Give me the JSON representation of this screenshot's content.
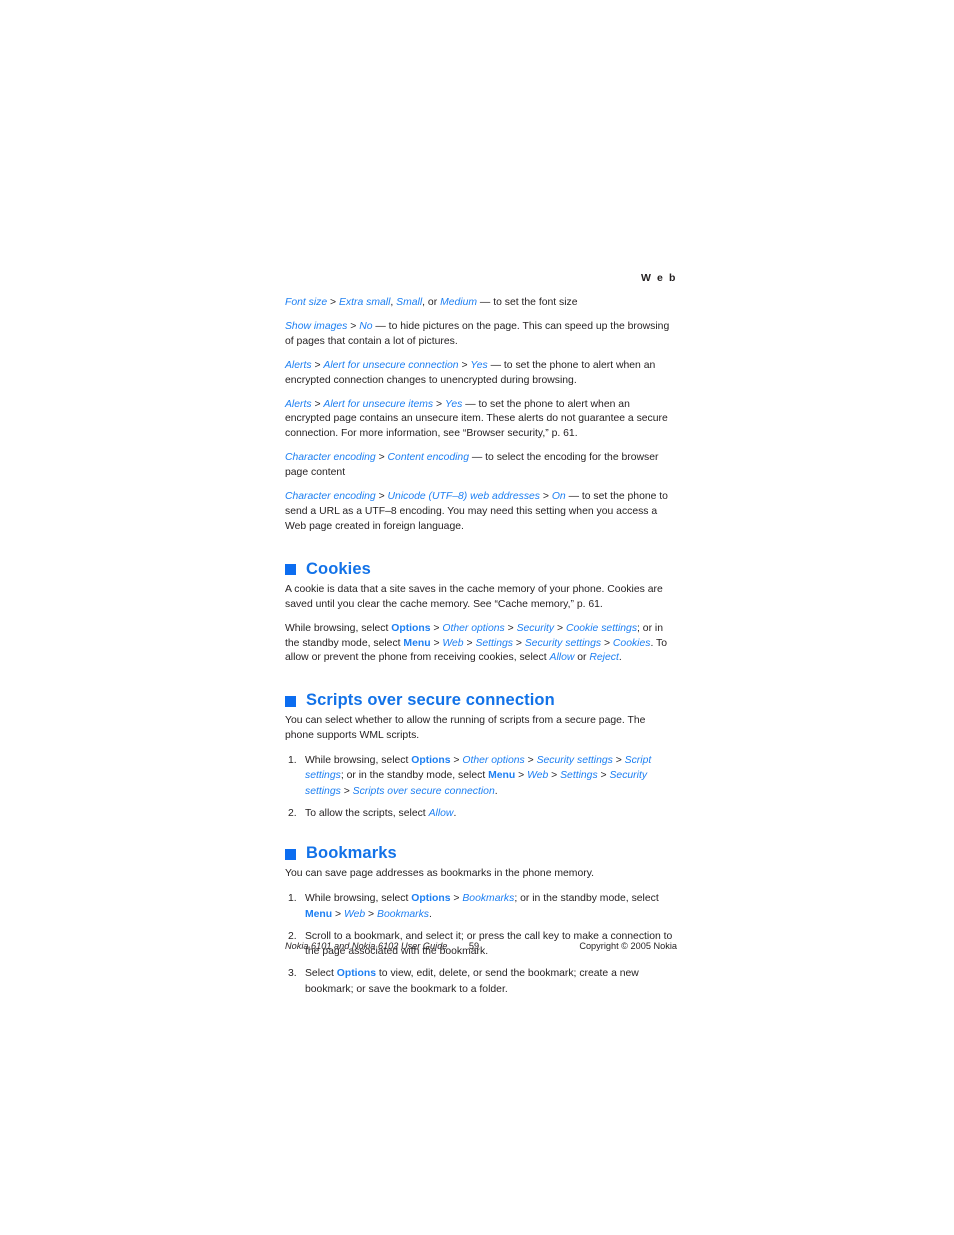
{
  "page": {
    "running_head": "W e b",
    "background": "#ffffff",
    "accent_blue": "#0c6df0",
    "link_blue": "#1d7ff2",
    "text_color": "#231f20"
  },
  "settings_paragraphs": [
    {
      "id": "font-size",
      "parts": [
        {
          "t": "term",
          "v": "Font size"
        },
        {
          "t": "sep",
          "v": " > "
        },
        {
          "t": "term",
          "v": "Extra small"
        },
        {
          "t": "plain",
          "v": ", "
        },
        {
          "t": "term",
          "v": "Small"
        },
        {
          "t": "plain",
          "v": ", or "
        },
        {
          "t": "term",
          "v": "Medium"
        },
        {
          "t": "plain",
          "v": " — to set the font size"
        }
      ]
    },
    {
      "id": "show-images",
      "parts": [
        {
          "t": "term",
          "v": "Show images"
        },
        {
          "t": "sep",
          "v": " > "
        },
        {
          "t": "term",
          "v": "No"
        },
        {
          "t": "plain",
          "v": " — to hide pictures on the page. This can speed up the browsing of pages that contain a lot of pictures."
        }
      ]
    },
    {
      "id": "alerts-unsecure-connection",
      "parts": [
        {
          "t": "term",
          "v": "Alerts"
        },
        {
          "t": "sep",
          "v": " > "
        },
        {
          "t": "term",
          "v": "Alert for unsecure connection"
        },
        {
          "t": "sep",
          "v": " > "
        },
        {
          "t": "term",
          "v": "Yes"
        },
        {
          "t": "plain",
          "v": " — to set the phone to alert when an encrypted connection changes to unencrypted during browsing."
        }
      ]
    },
    {
      "id": "alerts-unsecure-items",
      "parts": [
        {
          "t": "term",
          "v": "Alerts"
        },
        {
          "t": "sep",
          "v": " > "
        },
        {
          "t": "term",
          "v": "Alert for unsecure items"
        },
        {
          "t": "sep",
          "v": " > "
        },
        {
          "t": "term",
          "v": "Yes"
        },
        {
          "t": "plain",
          "v": " — to set the phone to alert when an encrypted page contains an unsecure item. These alerts do not guarantee a secure connection. For more information, see “Browser security,” p. 61."
        }
      ]
    },
    {
      "id": "character-encoding-content",
      "parts": [
        {
          "t": "term",
          "v": "Character encoding"
        },
        {
          "t": "sep",
          "v": " > "
        },
        {
          "t": "term",
          "v": "Content encoding"
        },
        {
          "t": "plain",
          "v": " — to select the encoding for the browser page content"
        }
      ]
    },
    {
      "id": "character-encoding-utf8",
      "parts": [
        {
          "t": "term",
          "v": "Character encoding"
        },
        {
          "t": "sep",
          "v": " > "
        },
        {
          "t": "term",
          "v": "Unicode (UTF–8) web addresses"
        },
        {
          "t": "sep",
          "v": " > "
        },
        {
          "t": "term",
          "v": "On"
        },
        {
          "t": "plain",
          "v": " — to set the phone to send a URL as a UTF–8 encoding. You may need this setting when you access a Web page created in foreign language."
        }
      ]
    }
  ],
  "sections": [
    {
      "id": "cookies",
      "heading": "Cookies",
      "paragraphs": [
        {
          "id": "cookies-intro",
          "parts": [
            {
              "t": "plain",
              "v": "A cookie is data that a site saves in the cache memory of your phone. Cookies are saved until you clear the cache memory. See “Cache memory,” p. 61."
            }
          ]
        },
        {
          "id": "cookies-path",
          "parts": [
            {
              "t": "plain",
              "v": "While browsing, select "
            },
            {
              "t": "key",
              "v": "Options"
            },
            {
              "t": "sep",
              "v": " > "
            },
            {
              "t": "term",
              "v": "Other options"
            },
            {
              "t": "sep",
              "v": " > "
            },
            {
              "t": "term",
              "v": "Security"
            },
            {
              "t": "sep",
              "v": " > "
            },
            {
              "t": "term",
              "v": "Cookie settings"
            },
            {
              "t": "plain",
              "v": "; or in the standby mode, select "
            },
            {
              "t": "key",
              "v": "Menu"
            },
            {
              "t": "sep",
              "v": " > "
            },
            {
              "t": "term",
              "v": "Web"
            },
            {
              "t": "sep",
              "v": " > "
            },
            {
              "t": "term",
              "v": "Settings"
            },
            {
              "t": "sep",
              "v": " > "
            },
            {
              "t": "term",
              "v": "Security settings"
            },
            {
              "t": "sep",
              "v": " > "
            },
            {
              "t": "term",
              "v": "Cookies"
            },
            {
              "t": "plain",
              "v": ". To allow or prevent the phone from receiving cookies, select "
            },
            {
              "t": "term",
              "v": "Allow"
            },
            {
              "t": "plain",
              "v": " or "
            },
            {
              "t": "term",
              "v": "Reject"
            },
            {
              "t": "plain",
              "v": "."
            }
          ]
        }
      ],
      "steps": []
    },
    {
      "id": "scripts-over-secure-connection",
      "heading": "Scripts over secure connection",
      "paragraphs": [
        {
          "id": "scripts-intro",
          "parts": [
            {
              "t": "plain",
              "v": "You can select whether to allow the running of scripts from a secure page. The phone supports WML scripts."
            }
          ]
        }
      ],
      "steps": [
        {
          "num": "1.",
          "parts": [
            {
              "t": "plain",
              "v": "While browsing, select "
            },
            {
              "t": "key",
              "v": "Options"
            },
            {
              "t": "sep",
              "v": " > "
            },
            {
              "t": "term",
              "v": "Other options"
            },
            {
              "t": "sep",
              "v": " > "
            },
            {
              "t": "term",
              "v": "Security settings"
            },
            {
              "t": "sep",
              "v": " > "
            },
            {
              "t": "term",
              "v": "Script settings"
            },
            {
              "t": "plain",
              "v": "; or in the standby mode, select "
            },
            {
              "t": "key",
              "v": "Menu"
            },
            {
              "t": "sep",
              "v": " > "
            },
            {
              "t": "term",
              "v": "Web"
            },
            {
              "t": "sep",
              "v": " > "
            },
            {
              "t": "term",
              "v": "Settings"
            },
            {
              "t": "sep",
              "v": " > "
            },
            {
              "t": "term",
              "v": "Security settings"
            },
            {
              "t": "sep",
              "v": " > "
            },
            {
              "t": "term",
              "v": "Scripts over secure connection"
            },
            {
              "t": "plain",
              "v": "."
            }
          ]
        },
        {
          "num": "2.",
          "parts": [
            {
              "t": "plain",
              "v": "To allow the scripts, select "
            },
            {
              "t": "term",
              "v": "Allow"
            },
            {
              "t": "plain",
              "v": "."
            }
          ]
        }
      ]
    },
    {
      "id": "bookmarks",
      "heading": "Bookmarks",
      "paragraphs": [
        {
          "id": "bookmarks-intro",
          "parts": [
            {
              "t": "plain",
              "v": "You can save page addresses as bookmarks in the phone memory."
            }
          ]
        }
      ],
      "steps": [
        {
          "num": "1.",
          "parts": [
            {
              "t": "plain",
              "v": "While browsing, select "
            },
            {
              "t": "key",
              "v": "Options"
            },
            {
              "t": "sep",
              "v": " > "
            },
            {
              "t": "term",
              "v": "Bookmarks"
            },
            {
              "t": "plain",
              "v": "; or in the standby mode, select "
            },
            {
              "t": "key",
              "v": "Menu"
            },
            {
              "t": "sep",
              "v": " > "
            },
            {
              "t": "term",
              "v": "Web"
            },
            {
              "t": "sep",
              "v": " > "
            },
            {
              "t": "term",
              "v": "Bookmarks"
            },
            {
              "t": "plain",
              "v": "."
            }
          ]
        },
        {
          "num": "2.",
          "parts": [
            {
              "t": "plain",
              "v": "Scroll to a bookmark, and select it; or press the call key to make a connection to the page associated with the bookmark."
            }
          ]
        },
        {
          "num": "3.",
          "parts": [
            {
              "t": "plain",
              "v": "Select "
            },
            {
              "t": "key",
              "v": "Options"
            },
            {
              "t": "plain",
              "v": " to view, edit, delete, or send the bookmark; create a new bookmark; or save the bookmark to a folder."
            }
          ]
        }
      ]
    }
  ],
  "footer": {
    "left": "Nokia 6101 and Nokia 6102 User Guide",
    "page_number": "59",
    "right": "Copyright © 2005 Nokia"
  }
}
